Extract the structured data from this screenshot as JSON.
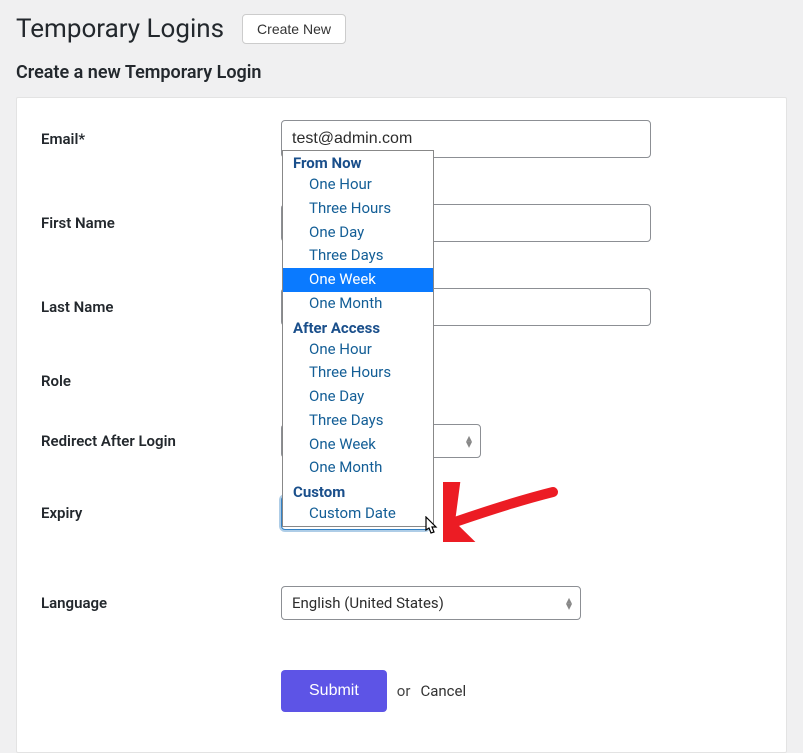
{
  "header": {
    "title": "Temporary Logins",
    "create_new": "Create New"
  },
  "subtitle": "Create a new Temporary Login",
  "form": {
    "email_label": "Email*",
    "email_value": "test@admin.com",
    "first_name_label": "First Name",
    "first_name_value": "",
    "last_name_label": "Last Name",
    "last_name_value": "",
    "role_label": "Role",
    "redirect_label": "Redirect After Login",
    "redirect_value": "",
    "expiry_label": "Expiry",
    "expiry_value": "One Week",
    "language_label": "Language",
    "language_value": "English (United States)"
  },
  "dropdown": {
    "group1": "From Now",
    "group2": "After Access",
    "group3": "Custom",
    "items_from_now": [
      "One Hour",
      "Three Hours",
      "One Day",
      "Three Days",
      "One Week",
      "One Month"
    ],
    "items_after": [
      "One Hour",
      "Three Hours",
      "One Day",
      "Three Days",
      "One Week",
      "One Month"
    ],
    "items_custom": [
      "Custom Date"
    ],
    "selected": "One Week"
  },
  "actions": {
    "submit": "Submit",
    "or": "or",
    "cancel": "Cancel"
  }
}
